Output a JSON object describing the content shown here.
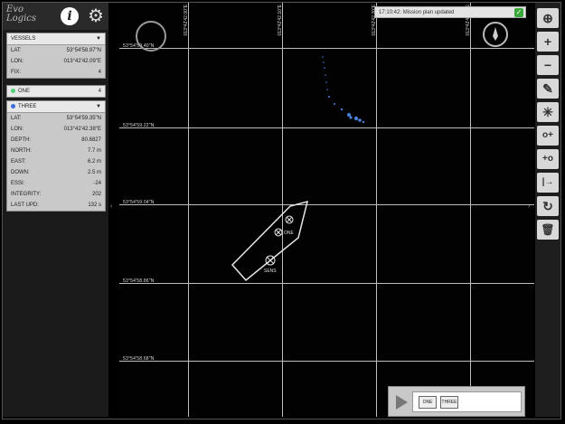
{
  "logo": {
    "line1": "Evo",
    "line2": "Logics"
  },
  "header": {
    "info_glyph": "i",
    "gear_glyph": "⚙"
  },
  "vessels": {
    "title": "VESSELS",
    "rows": [
      {
        "label": "LAT:",
        "value": "53°54'58.97\"N"
      },
      {
        "label": "LON:",
        "value": "013°42'42.09\"E"
      },
      {
        "label": "FIX:",
        "value": "4"
      }
    ]
  },
  "one": {
    "title": "ONE",
    "count": "4",
    "color": "#4fd27a"
  },
  "three": {
    "title": "THREE",
    "color": "#3f6fe0",
    "rows": [
      {
        "label": "LAT:",
        "value": "53°54'59.35\"N"
      },
      {
        "label": "LON:",
        "value": "013°42'42.38\"E"
      },
      {
        "label": "DEPTH:",
        "value": "80.6827"
      },
      {
        "label": "NORTH:",
        "value": "7.7 m"
      },
      {
        "label": "EAST:",
        "value": "6.2 m"
      },
      {
        "label": "DOWN:",
        "value": "2.5 m"
      },
      {
        "label": "ESSI:",
        "value": "-24"
      },
      {
        "label": "INTEGRITY:",
        "value": "202"
      },
      {
        "label": "LAST UPD:",
        "value": "132 s"
      }
    ]
  },
  "map": {
    "toast": "17:10:42: Mission plan updated",
    "lat_labels": [
      "53°54'59.22\"N",
      "53°54'59.04\"N",
      "53°54'58.86\"N",
      "53°54'58.68\"N"
    ],
    "top_lat_label": "53°54'59.40\"N",
    "lon_labels": [
      "013°42'42.00\"E",
      "013°42'42.10\"E",
      "013°42'42.20\"E",
      "013°42'42.30\"E"
    ],
    "boat_labels": {
      "top": "ONE",
      "bottom": "SENS"
    }
  },
  "playback": {
    "chips": [
      "ONE",
      "THREE"
    ]
  },
  "toolbar": {
    "tools": [
      {
        "name": "zoom-fit",
        "glyph": "⊕"
      },
      {
        "name": "zoom-in",
        "glyph": "+"
      },
      {
        "name": "zoom-out",
        "glyph": "−"
      },
      {
        "name": "pencil",
        "glyph": "✎"
      },
      {
        "name": "sparkle",
        "glyph": "✳"
      },
      {
        "name": "add-waypoint",
        "glyph": "o+"
      },
      {
        "name": "insert-waypoint",
        "glyph": "+o"
      },
      {
        "name": "go-to",
        "glyph": "|→"
      },
      {
        "name": "refresh",
        "glyph": "↻"
      },
      {
        "name": "trash",
        "glyph": "🗑"
      }
    ]
  }
}
